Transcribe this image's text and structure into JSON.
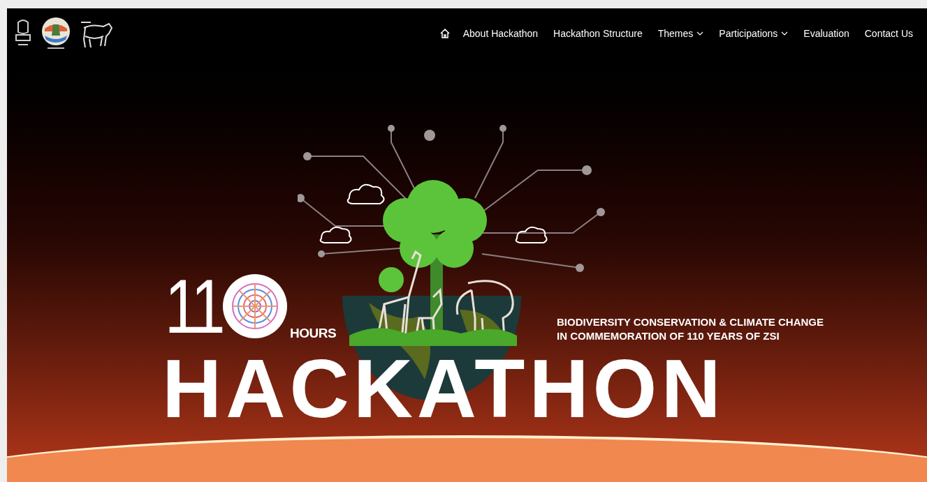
{
  "nav": {
    "items": [
      {
        "label": "About Hackathon",
        "has_dropdown": false
      },
      {
        "label": "Hackathon Structure",
        "has_dropdown": false
      },
      {
        "label": "Themes",
        "has_dropdown": true
      },
      {
        "label": "Participations",
        "has_dropdown": true
      },
      {
        "label": "Evaluation",
        "has_dropdown": false
      },
      {
        "label": "Contact Us",
        "has_dropdown": false
      }
    ]
  },
  "hero": {
    "count": "11",
    "unit": "HOURS",
    "tagline": [
      "BIODIVERSITY CONSERVATION & CLIMATE CHANGE",
      "IN COMMEMORATION OF 110 YEARS OF ZSI"
    ],
    "title": "HACKATHON"
  }
}
